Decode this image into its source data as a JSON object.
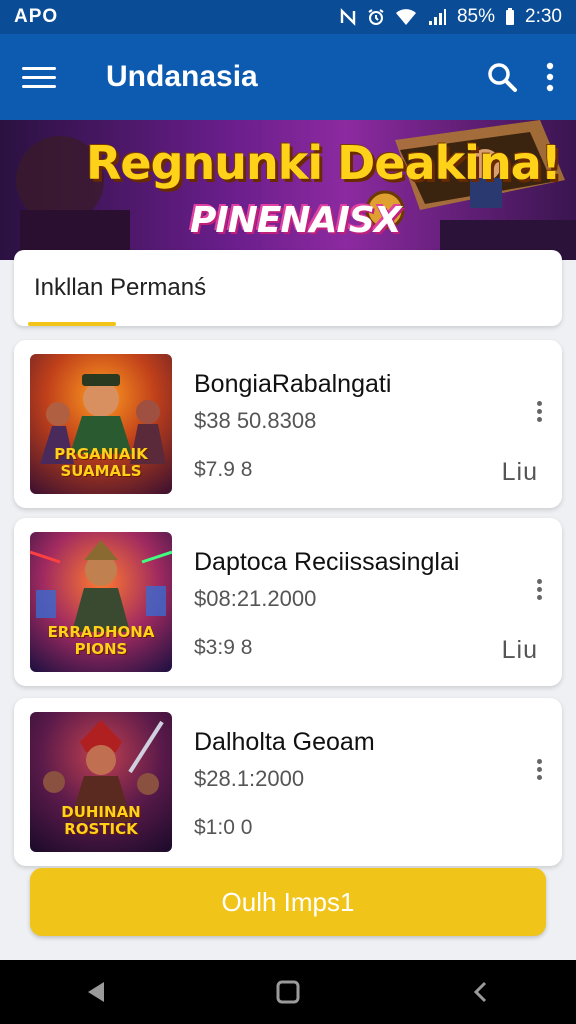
{
  "status_bar": {
    "left_text": "APO",
    "battery": "85%",
    "time": "2:30",
    "icons": [
      "nfc-icon",
      "alarm-icon",
      "wifi-icon",
      "signal-icon",
      "battery-icon"
    ]
  },
  "app_bar": {
    "title": "Undanasia",
    "icons": [
      "menu-icon",
      "search-icon",
      "more-vert-icon"
    ]
  },
  "banner": {
    "title": "Regnunki Deakina!",
    "subtitle": "PINENAISX"
  },
  "search": {
    "text": "Inkllan Permanś"
  },
  "games": [
    {
      "name": "BongiaRabalngati",
      "price": "$38 50.8308",
      "sub_price": "$7.9 8",
      "link": "Liu",
      "thumb_text": "PRGANIAIK SUAMALS"
    },
    {
      "name": "Daptoca Reciissasinglai",
      "price": "$08:21.2000",
      "sub_price": "$3:9 8",
      "link": "Liu",
      "thumb_text": "ERRADHONA PIONS"
    },
    {
      "name": "Dalholta Geoam",
      "price": "$28.1:2000",
      "sub_price": "$1:0 0",
      "link": "",
      "thumb_text": "DUHINAN ROSTICK"
    }
  ],
  "cta": {
    "label": "Oulh Imps1"
  },
  "colors": {
    "status_bar": "#0a4c95",
    "app_bar": "#0d5bb0",
    "accent": "#f0c419",
    "background": "#eef0f3"
  }
}
